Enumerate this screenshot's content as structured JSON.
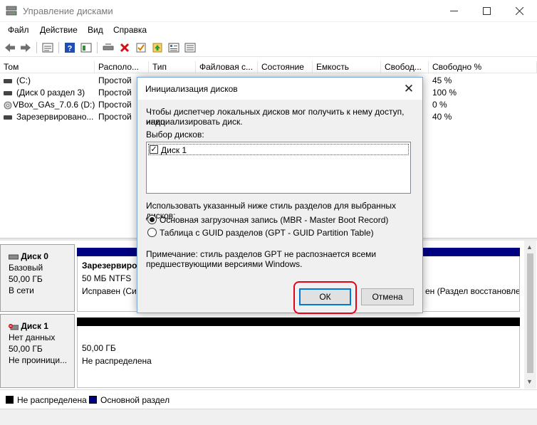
{
  "window": {
    "title": "Управление дисками",
    "icon": "disk-management-icon",
    "controls": [
      "minimize-icon",
      "maximize-icon",
      "close-icon"
    ]
  },
  "menu": [
    "Файл",
    "Действие",
    "Вид",
    "Справка"
  ],
  "toolbar": [
    "back-arrow-icon",
    "forward-arrow-icon",
    "properties-icon",
    "help-icon",
    "view-icon",
    "connect-disk-icon",
    "delete-icon",
    "check-icon",
    "upload-icon",
    "list-icon"
  ],
  "volumes": {
    "columns": [
      "Том",
      "Располо...",
      "Тип",
      "Файловая с...",
      "Состояние",
      "Емкость",
      "Свобод...",
      "Свободно %"
    ],
    "rows": [
      {
        "name": "(C:)",
        "layout": "Простой",
        "free_pct": "45 %"
      },
      {
        "name": "(Диск 0 раздел 3)",
        "layout": "Простой",
        "free_pct": "100 %"
      },
      {
        "name": "VBox_GAs_7.0.6 (D:)",
        "layout": "Простой",
        "free_pct": "0 %"
      },
      {
        "name": "Зарезервировано...",
        "layout": "Простой",
        "free_pct": "40 %"
      }
    ]
  },
  "disks": [
    {
      "name": "Диск 0",
      "type": "Базовый",
      "size": "50,00 ГБ",
      "status": "В сети",
      "partition": {
        "label": "Зарезервиро",
        "size": "50 МБ NTFS",
        "status": "Исправен (Сис"
      },
      "right_partition_status": "ен (Раздел восстановле"
    },
    {
      "name": "Диск 1",
      "type": "Нет данных",
      "size": "50,00 ГБ",
      "status": "Не проиници...",
      "partition": {
        "size": "50,00 ГБ",
        "status": "Не распределена"
      }
    }
  ],
  "legend": [
    {
      "label": "Не распределена",
      "color": "#000000"
    },
    {
      "label": "Основной раздел",
      "color": "#000080"
    }
  ],
  "dialog": {
    "title": "Инициализация дисков",
    "intro_line1": "Чтобы диспетчер локальных дисков мог получить к нему доступ, надо",
    "intro_line2": "инициализировать диск.",
    "select_label": "Выбор дисков:",
    "disk_item": "Диск 1",
    "disk_item_checked": true,
    "style_label": "Использовать указанный ниже стиль разделов для выбранных дисков:",
    "option_mbr": "Основная загрузочная запись (MBR - Master Boot Record)",
    "option_gpt": "Таблица с GUID разделов (GPT - GUID Partition Table)",
    "selected_option": "mbr",
    "note_line1": "Примечание: стиль разделов GPT не распознается всеми",
    "note_line2": "предшествующими версиями Windows.",
    "ok_label": "ОК",
    "cancel_label": "Отмена"
  },
  "colors": {
    "primary_partition": "#000080",
    "unallocated": "#000000",
    "highlight": "#e8001c",
    "focus": "#0078d7"
  }
}
